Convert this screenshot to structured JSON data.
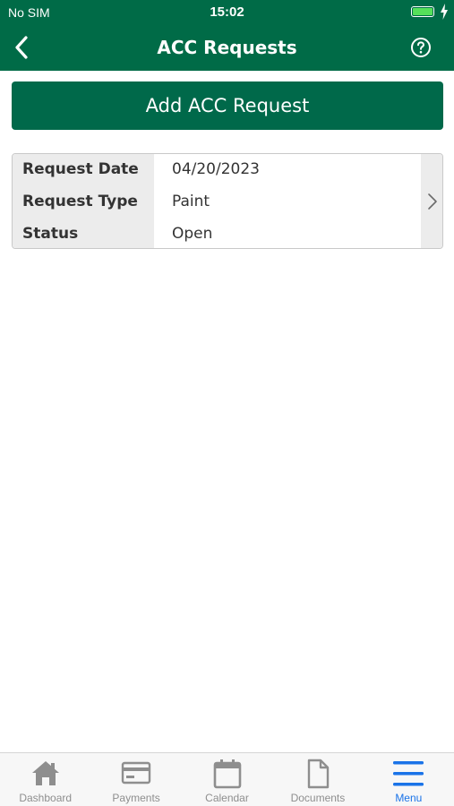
{
  "status_bar": {
    "carrier": "No SIM",
    "time": "15:02"
  },
  "header": {
    "title": "ACC Requests"
  },
  "actions": {
    "add_label": "Add ACC Request"
  },
  "requests": [
    {
      "fields": [
        {
          "label": "Request Date",
          "value": "04/20/2023"
        },
        {
          "label": "Request Type",
          "value": "Paint"
        },
        {
          "label": "Status",
          "value": "Open"
        }
      ]
    }
  ],
  "tabbar": {
    "items": [
      {
        "label": "Dashboard",
        "icon": "home-icon"
      },
      {
        "label": "Payments",
        "icon": "credit-card-icon"
      },
      {
        "label": "Calendar",
        "icon": "calendar-icon"
      },
      {
        "label": "Documents",
        "icon": "document-icon"
      },
      {
        "label": "Menu",
        "icon": "menu-icon"
      }
    ],
    "active": "Menu"
  },
  "colors": {
    "brand_green": "#006b47",
    "active_tab": "#1a73e8",
    "inactive_tab": "#8e8e8e"
  }
}
